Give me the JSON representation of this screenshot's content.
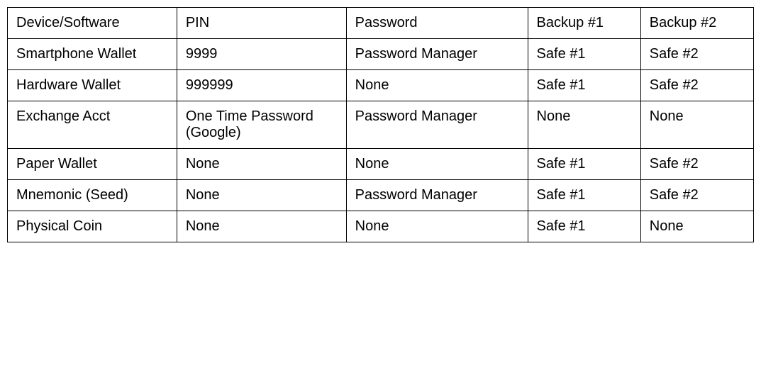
{
  "chart_data": {
    "type": "table",
    "headers": [
      "Device/Software",
      "PIN",
      "Password",
      "Backup #1",
      "Backup #2"
    ],
    "rows": [
      [
        "Smartphone Wallet",
        "9999",
        "Password Manager",
        "Safe #1",
        "Safe #2"
      ],
      [
        "Hardware Wallet",
        "999999",
        "None",
        "Safe #1",
        "Safe #2"
      ],
      [
        "Exchange Acct",
        "One Time Password (Google)",
        "Password Manager",
        "None",
        "None"
      ],
      [
        "Paper Wallet",
        "None",
        "None",
        "Safe #1",
        "Safe #2"
      ],
      [
        "Mnemonic (Seed)",
        "None",
        "Password Manager",
        "Safe #1",
        "Safe #2"
      ],
      [
        "Physical Coin",
        "None",
        "None",
        "Safe #1",
        "None"
      ]
    ]
  }
}
